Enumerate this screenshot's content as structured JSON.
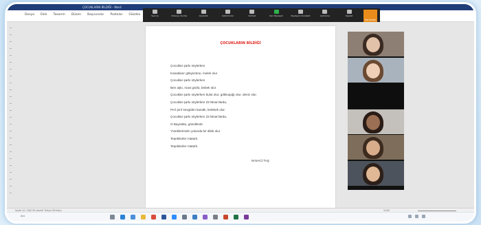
{
  "app": {
    "title": "ÇOCUKLARIN BİLDİĞİ - Word"
  },
  "ribbon": {
    "tabs": [
      "Dosya",
      "Ekle",
      "Tasarım",
      "Düzen",
      "Başvurular",
      "Postalar",
      "Gözden"
    ]
  },
  "zoom_toolbar": {
    "items": [
      {
        "label": "Sesi Aç",
        "icon": "microphone-icon",
        "color": "#bbbbbb"
      },
      {
        "label": "Videoyu Durdur",
        "icon": "camera-icon",
        "color": "#bbbbbb"
      },
      {
        "label": "Güvenlik",
        "icon": "shield-icon",
        "color": "#bbbbbb"
      },
      {
        "label": "Katılımcılar",
        "icon": "participants-icon",
        "color": "#bbbbbb"
      },
      {
        "label": "Sohbet",
        "icon": "chat-icon",
        "color": "#bbbbbb"
      },
      {
        "label": "Yeni Paylaşım",
        "icon": "share-icon",
        "color": "#2fb24a"
      },
      {
        "label": "Paylaşımı Duraklat",
        "icon": "pause-icon",
        "color": "#bbbbbb"
      },
      {
        "label": "Açıklama",
        "icon": "annotate-icon",
        "color": "#bbbbbb"
      },
      {
        "label": "Kaydet",
        "icon": "record-icon",
        "color": "#bbbbbb"
      }
    ],
    "end_label": "Sonlandır",
    "end_color": "#e98c1b"
  },
  "share_strip": {
    "sharing_label": "Ekran paylaşıyorsunuz",
    "stop_label": "Paylaşımı Durdur"
  },
  "document": {
    "title": "ÇOCUKLARIN BİLDİĞİ",
    "title_color": "#e0251f",
    "lines": [
      "Çocuklar şarkı söylerken",
      "Kanatlanır gökyüzüne, melek olur",
      "Çocuklar şarkı söylerken",
      "Ben aşkı, mavi gözlü, bebek olur",
      "Çocuklar şarkı söylerken bulut olur, gökkuşağı olur, deniz olur.",
      "Çocuklar şarkı söylerken 23 Nisan'larda,",
      "Pırıl pırıl sevgiden kanatlı, kelebek olur.",
      "Çocuklar şarkı söylerken 23 Nisan'larda,",
      "O Bayrakta, gönüllerde",
      "Yüreklerimizin yolunda bir dilek olur",
      "Teşekkürler Atatürk.",
      "Teşekkürler Atatürk."
    ],
    "author": "M.NACİ TAŞ"
  },
  "gallery": {
    "participants": [
      {
        "name": "",
        "bg": "#8d7f73",
        "face": "#e2c2a8",
        "hair": "#3b2a22"
      },
      {
        "name": "",
        "bg": "#a9b3bd",
        "face": "#efcfb5",
        "hair": "#6b4a32"
      },
      {
        "name": "",
        "bg": "#0e0e0e",
        "face": "#0e0e0e",
        "hair": "#0e0e0e"
      },
      {
        "name": "",
        "bg": "#c4c0bb",
        "face": "#9b6f53",
        "hair": "#2a1c16"
      },
      {
        "name": "",
        "bg": "#7e6d5a",
        "face": "#d8ad8c",
        "hair": "#3d2b1f"
      },
      {
        "name": "",
        "bg": "#4d535c",
        "face": "#e0b895",
        "hair": "#2c1f19"
      }
    ]
  },
  "status": {
    "left": "Sayfa 1/1  116/116 sözcük  Türkçe (Türkiye)",
    "right": "%100"
  },
  "taskbar": {
    "search_label": "Ara",
    "apps": [
      {
        "icon": "task-view-icon",
        "color": "#7d8896"
      },
      {
        "icon": "edge-icon",
        "color": "#2a82d6"
      },
      {
        "icon": "store-icon",
        "color": "#4a8fd9"
      },
      {
        "icon": "explorer-icon",
        "color": "#e8b93a"
      },
      {
        "icon": "chrome-icon",
        "color": "#d94a3a"
      },
      {
        "icon": "word-icon",
        "color": "#2b579a"
      },
      {
        "icon": "zoom-icon",
        "color": "#2d8cff"
      },
      {
        "icon": "mail-icon",
        "color": "#6a7a8b"
      },
      {
        "icon": "photos-icon",
        "color": "#3d7fc4"
      },
      {
        "icon": "media-icon",
        "color": "#8a5cc8"
      },
      {
        "icon": "settings-icon",
        "color": "#7a7f86"
      },
      {
        "icon": "powerpoint-icon",
        "color": "#c8472c"
      },
      {
        "icon": "excel-icon",
        "color": "#217346"
      },
      {
        "icon": "onenote-icon",
        "color": "#7a3b9b"
      }
    ]
  }
}
